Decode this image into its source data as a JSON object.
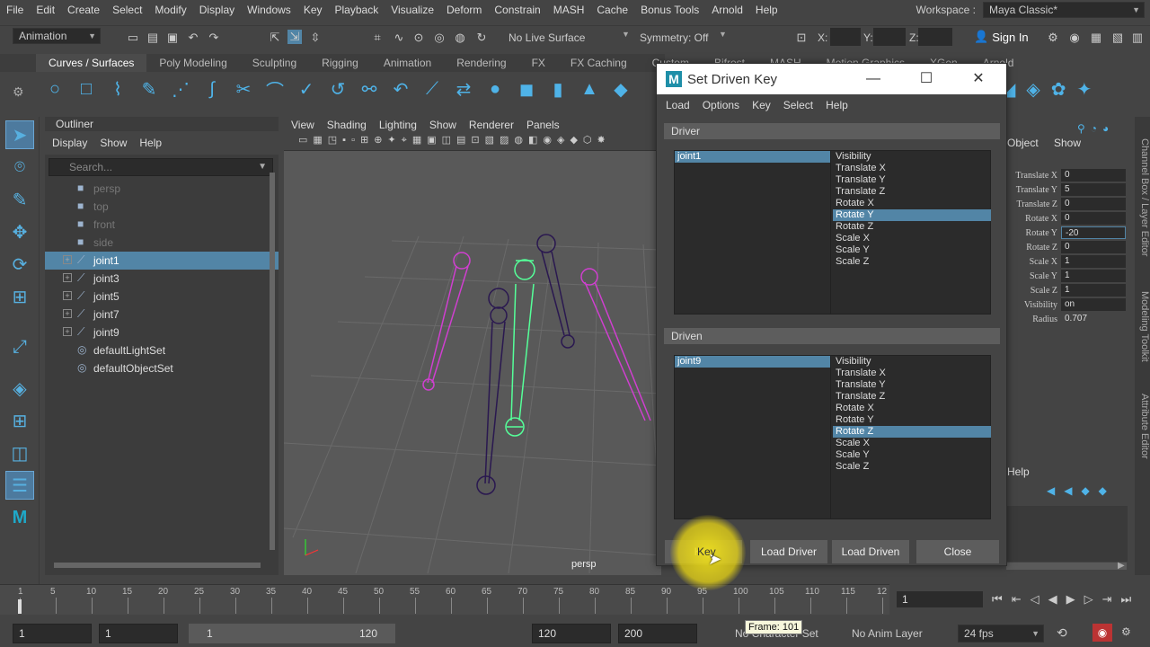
{
  "menubar": [
    "File",
    "Edit",
    "Create",
    "Select",
    "Modify",
    "Display",
    "Windows",
    "Key",
    "Playback",
    "Visualize",
    "Deform",
    "Constrain",
    "MASH",
    "Cache",
    "Bonus Tools",
    "Arnold",
    "Help"
  ],
  "workspace": {
    "label": "Workspace :",
    "value": "Maya Classic*"
  },
  "status": {
    "mode": "Animation",
    "live_surface": "No Live Surface",
    "symmetry": "Symmetry: Off",
    "x": "X:",
    "y": "Y:",
    "z": "Z:",
    "sign_in": "Sign In"
  },
  "shelf_tabs": [
    "Curves / Surfaces",
    "Poly Modeling",
    "Sculpting",
    "Rigging",
    "Animation",
    "Rendering",
    "FX",
    "FX Caching",
    "Custom",
    "Bifrost",
    "MASH",
    "Motion Graphics",
    "XGen",
    "Arnold"
  ],
  "outliner": {
    "title": "Outliner",
    "menu": [
      "Display",
      "Show",
      "Help"
    ],
    "search_placeholder": "Search...",
    "items": [
      {
        "label": "persp",
        "dim": true,
        "icon": "camera-icon"
      },
      {
        "label": "top",
        "dim": true,
        "icon": "camera-icon"
      },
      {
        "label": "front",
        "dim": true,
        "icon": "camera-icon"
      },
      {
        "label": "side",
        "dim": true,
        "icon": "camera-icon"
      },
      {
        "label": "joint1",
        "sel": true,
        "icon": "joint-icon",
        "expand": "+"
      },
      {
        "label": "joint3",
        "icon": "joint-icon",
        "expand": "+"
      },
      {
        "label": "joint5",
        "icon": "joint-icon",
        "expand": "+"
      },
      {
        "label": "joint7",
        "icon": "joint-icon",
        "expand": "+"
      },
      {
        "label": "joint9",
        "icon": "joint-icon",
        "expand": "+"
      },
      {
        "label": "defaultLightSet",
        "icon": "set-icon"
      },
      {
        "label": "defaultObjectSet",
        "icon": "set-icon"
      }
    ]
  },
  "viewport": {
    "menu": [
      "View",
      "Shading",
      "Lighting",
      "Show",
      "Renderer",
      "Panels"
    ],
    "camera": "persp"
  },
  "sdk": {
    "title": "Set Driven Key",
    "menu": [
      "Load",
      "Options",
      "Key",
      "Select",
      "Help"
    ],
    "driver_label": "Driver",
    "driven_label": "Driven",
    "driver_object": "joint1",
    "driven_object": "joint9",
    "attrs": [
      "Visibility",
      "Translate X",
      "Translate Y",
      "Translate Z",
      "Rotate X",
      "Rotate Y",
      "Rotate Z",
      "Scale X",
      "Scale Y",
      "Scale Z"
    ],
    "driver_selected": "Rotate Y",
    "driven_selected": "Rotate Z",
    "buttons": {
      "key": "Key",
      "load_driver": "Load Driver",
      "load_driven": "Load Driven",
      "close": "Close"
    }
  },
  "channel_box": {
    "header_object": "Object",
    "header_show": "Show",
    "channels": [
      {
        "label": "Translate X",
        "value": "0"
      },
      {
        "label": "Translate Y",
        "value": "5"
      },
      {
        "label": "Translate Z",
        "value": "0"
      },
      {
        "label": "Rotate X",
        "value": "0"
      },
      {
        "label": "Rotate Y",
        "value": "-20"
      },
      {
        "label": "Rotate Z",
        "value": "0"
      },
      {
        "label": "Scale X",
        "value": "1"
      },
      {
        "label": "Scale Y",
        "value": "1"
      },
      {
        "label": "Scale Z",
        "value": "1"
      },
      {
        "label": "Visibility",
        "value": "on"
      },
      {
        "label": "Radius",
        "value": "0.707"
      }
    ],
    "layer_help": "Help"
  },
  "side_tabs": [
    "Channel Box / Layer Editor",
    "Modeling Toolkit",
    "Attribute Editor"
  ],
  "timeline": {
    "ticks": [
      "1",
      "5",
      "10",
      "15",
      "20",
      "25",
      "30",
      "35",
      "40",
      "45",
      "50",
      "55",
      "60",
      "65",
      "70",
      "75",
      "80",
      "85",
      "90",
      "95",
      "100",
      "105",
      "110",
      "115",
      "12"
    ],
    "current_frame": "1"
  },
  "range": {
    "start": "1",
    "playback_start": "1",
    "slider_start": "1",
    "slider_end": "120",
    "playback_end": "120",
    "end": "200",
    "char_set": "No Character Set",
    "anim_layer": "No Anim Layer",
    "fps": "24 fps"
  },
  "tooltip": "Frame: 101",
  "colors": {
    "selection": "#5285a6",
    "icon_blue": "#4fb3e8",
    "joint_selected": "#55ff99",
    "joint_magenta": "#d03fd0"
  }
}
